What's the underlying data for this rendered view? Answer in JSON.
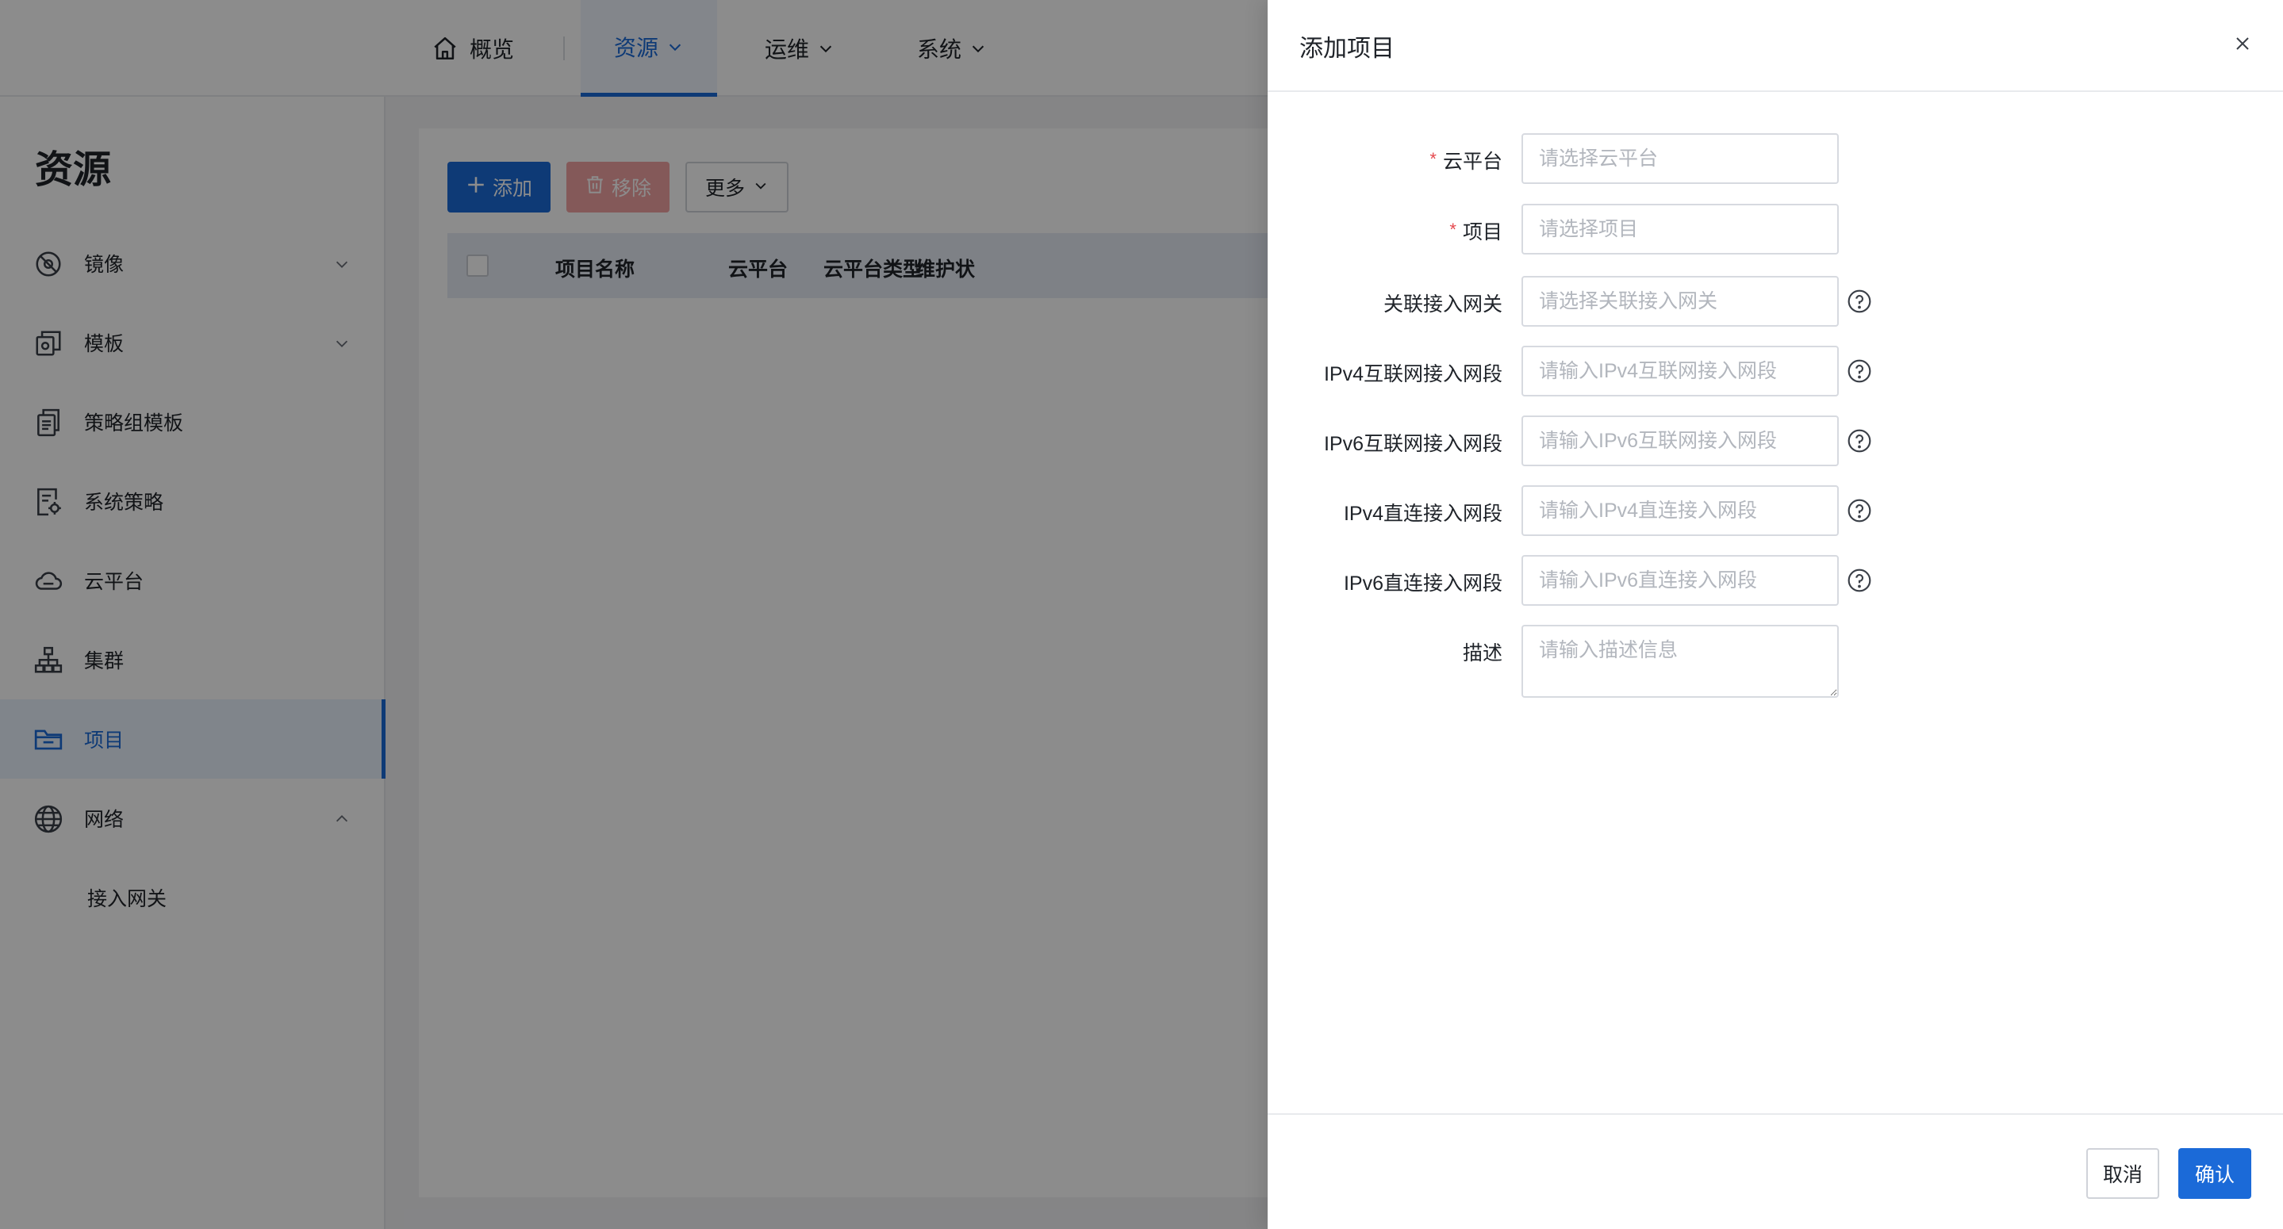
{
  "colors": {
    "accent": "#1b6ad8",
    "danger_light": "#f1a3a2",
    "required": "#e5484d",
    "overlay": "rgba(0,0,0,0.45)"
  },
  "topnav": {
    "items": [
      {
        "label": "概览",
        "icon": "home-icon"
      },
      {
        "label": "资源",
        "icon": "chevron-down-icon",
        "active": true
      },
      {
        "label": "运维",
        "icon": "chevron-down-icon"
      },
      {
        "label": "系统",
        "icon": "chevron-down-icon"
      }
    ]
  },
  "sidebar": {
    "title": "资源",
    "items": [
      {
        "label": "镜像",
        "icon": "image-icon",
        "expandable": true
      },
      {
        "label": "模板",
        "icon": "template-icon",
        "expandable": true
      },
      {
        "label": "策略组模板",
        "icon": "document-icon"
      },
      {
        "label": "系统策略",
        "icon": "policy-icon"
      },
      {
        "label": "云平台",
        "icon": "cloud-icon"
      },
      {
        "label": "集群",
        "icon": "cluster-icon"
      },
      {
        "label": "项目",
        "icon": "folder-icon",
        "active": true
      },
      {
        "label": "网络",
        "icon": "globe-icon",
        "expanded": true
      }
    ],
    "sub_items": [
      {
        "label": "接入网关"
      }
    ]
  },
  "toolbar": {
    "add_label": "添加",
    "remove_label": "移除",
    "more_label": "更多"
  },
  "table": {
    "columns": [
      "项目名称",
      "云平台",
      "云平台类型",
      "维护状"
    ]
  },
  "drawer": {
    "title": "添加项目",
    "fields": [
      {
        "label": "云平台",
        "required": true,
        "placeholder": "请选择云平台"
      },
      {
        "label": "项目",
        "required": true,
        "placeholder": "请选择项目"
      },
      {
        "label": "关联接入网关",
        "placeholder": "请选择关联接入网关",
        "help": true
      },
      {
        "label": "IPv4互联网接入网段",
        "placeholder": "请输入IPv4互联网接入网段",
        "help": true
      },
      {
        "label": "IPv6互联网接入网段",
        "placeholder": "请输入IPv6互联网接入网段",
        "help": true
      },
      {
        "label": "IPv4直连接入网段",
        "placeholder": "请输入IPv4直连接入网段",
        "help": true
      },
      {
        "label": "IPv6直连接入网段",
        "placeholder": "请输入IPv6直连接入网段",
        "help": true
      },
      {
        "label": "描述",
        "placeholder": "请输入描述信息"
      }
    ],
    "cancel_label": "取消",
    "confirm_label": "确认"
  }
}
